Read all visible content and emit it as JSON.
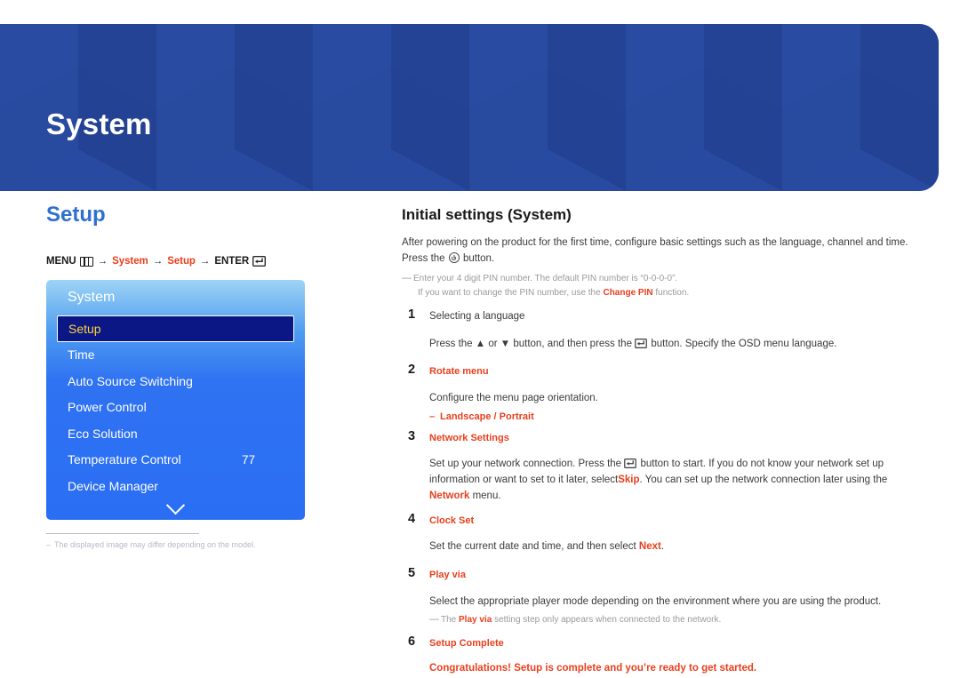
{
  "banner": {
    "title": "System",
    "bg_color": "#27479b"
  },
  "left": {
    "section_title": "Setup",
    "breadcrumb": {
      "menu_label": "MENU",
      "menu_icon": "menu-bars-icon",
      "arrow": "→",
      "crumb1": "System",
      "crumb2": "Setup",
      "enter_label": "ENTER",
      "enter_icon": "enter-key-icon",
      "accent_color": "#e8401e"
    },
    "osd": {
      "header": "System",
      "items": [
        {
          "label": "Setup",
          "value": "",
          "selected": true
        },
        {
          "label": "Time",
          "value": "",
          "selected": false
        },
        {
          "label": "Auto Source Switching",
          "value": "",
          "selected": false
        },
        {
          "label": "Power Control",
          "value": "",
          "selected": false
        },
        {
          "label": "Eco Solution",
          "value": "",
          "selected": false
        },
        {
          "label": "Temperature Control",
          "value": "77",
          "selected": false
        },
        {
          "label": "Device Manager",
          "value": "",
          "selected": false
        }
      ],
      "more_icon": "chevron-down-icon",
      "selected_text_color": "#ffd23e",
      "selected_bg_color": "#0a1784"
    },
    "footnote": {
      "dash": "–",
      "text": "The displayed image may differ depending on the model."
    }
  },
  "right": {
    "title": "Initial settings (System)",
    "intro_line1": "After powering on the product for the first time, configure basic settings such as the language, channel and time.",
    "intro_line2_pre": "Press the",
    "intro_power_icon": "power-button-icon",
    "intro_line2_post": "button.",
    "pin_note": {
      "dash": "—",
      "line1": "Enter your 4 digit PIN number. The default PIN number is “0-0-0-0”.",
      "line2_pre": "If you want to change the PIN number, use the",
      "line2_accent": "Change PIN",
      "line2_post": "function."
    },
    "steps": [
      {
        "num": "1",
        "head": "Selecting a language",
        "head_accent": false,
        "body_pre": "Press the ▲ or ▼ button, and then press the",
        "body_icon": "enter-key-icon",
        "body_post": "button. Specify the OSD menu language."
      },
      {
        "num": "2",
        "head": "Rotate menu",
        "head_accent": true,
        "body": "Configure the menu page orientation.",
        "bullet_dash": "–",
        "bullet": "Landscape / Portrait"
      },
      {
        "num": "3",
        "head": "Network Settings",
        "head_accent": true,
        "body_p1": "Set up your network connection. Press the",
        "body_icon": "enter-key-icon",
        "body_p2": "button to start. If you do not know your network set up information or want to set to it later, select",
        "body_accent1": "Skip",
        "body_p3": ". You can set up the network connection later using the",
        "body_accent2": "Network",
        "body_p4": "menu."
      },
      {
        "num": "4",
        "head": "Clock Set",
        "head_accent": true,
        "body_pre": "Set the current date and time, and then select",
        "body_accent": "Next",
        "body_post": "."
      },
      {
        "num": "5",
        "head": "Play via",
        "head_accent": true,
        "body": "Select the appropriate player mode depending on the environment where you are using the product.",
        "note_dash": "—",
        "note_pre": "The",
        "note_accent": "Play via",
        "note_post": "setting step only appears when connected to the network."
      },
      {
        "num": "6",
        "head": "Setup Complete",
        "head_accent": true,
        "final": "Congratulations! Setup is complete and you’re ready to get started."
      }
    ],
    "accent_color": "#e8401e"
  }
}
